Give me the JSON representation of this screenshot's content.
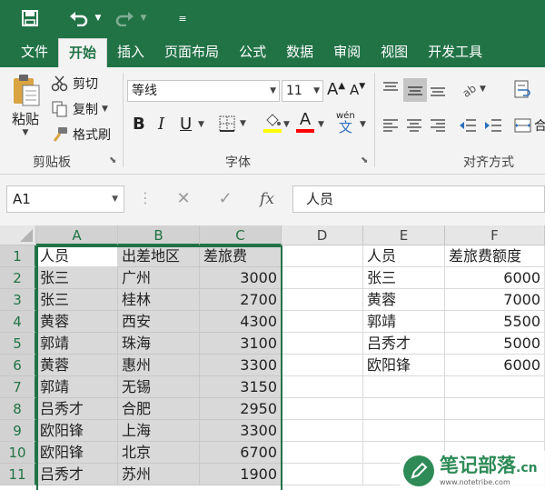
{
  "quick_access": {
    "save_icon": "save-icon",
    "undo_icon": "undo-icon",
    "redo_icon": "redo-icon",
    "customize_icon": "customize-icon"
  },
  "tabs": [
    {
      "label": "文件"
    },
    {
      "label": "开始",
      "active": true
    },
    {
      "label": "插入"
    },
    {
      "label": "页面布局"
    },
    {
      "label": "公式"
    },
    {
      "label": "数据"
    },
    {
      "label": "审阅"
    },
    {
      "label": "视图"
    },
    {
      "label": "开发工具"
    }
  ],
  "ribbon": {
    "clipboard": {
      "paste": "粘贴",
      "cut": "剪切",
      "copy": "复制",
      "format_painter": "格式刷",
      "label": "剪贴板"
    },
    "font": {
      "name": "等线",
      "size": "11",
      "label": "字体",
      "bold": "B",
      "italic": "I",
      "underline": "U",
      "grow": "A",
      "shrink": "A",
      "font_color": "A",
      "phonetic_top": "wén",
      "phonetic_bottom": "文",
      "fill_color": "#ffff00",
      "text_color": "#ff0000"
    },
    "alignment": {
      "label": "对齐方式",
      "merge_partial": "合"
    }
  },
  "formula_bar": {
    "name_box": "A1",
    "cancel": "✕",
    "enter": "✓",
    "fx": "fx",
    "content": "人员"
  },
  "grid": {
    "columns": [
      "A",
      "B",
      "C",
      "D",
      "E",
      "F"
    ],
    "rows": [
      "1",
      "2",
      "3",
      "4",
      "5",
      "6",
      "7",
      "8",
      "9",
      "10",
      "11"
    ],
    "cells": [
      [
        "人员",
        "出差地区",
        "差旅费",
        "",
        "人员",
        "差旅费额度"
      ],
      [
        "张三",
        "广州",
        "3000",
        "",
        "张三",
        "6000"
      ],
      [
        "张三",
        "桂林",
        "2700",
        "",
        "黄蓉",
        "7000"
      ],
      [
        "黄蓉",
        "西安",
        "4300",
        "",
        "郭靖",
        "5500"
      ],
      [
        "郭靖",
        "珠海",
        "3100",
        "",
        "吕秀才",
        "5000"
      ],
      [
        "黄蓉",
        "惠州",
        "3300",
        "",
        "欧阳锋",
        "6000"
      ],
      [
        "郭靖",
        "无锡",
        "3150",
        "",
        "",
        ""
      ],
      [
        "吕秀才",
        "合肥",
        "2950",
        "",
        "",
        ""
      ],
      [
        "欧阳锋",
        "上海",
        "3300",
        "",
        "",
        ""
      ],
      [
        "欧阳锋",
        "北京",
        "6700",
        "",
        "",
        ""
      ],
      [
        "吕秀才",
        "苏州",
        "1900",
        "",
        "",
        ""
      ]
    ]
  },
  "watermark": {
    "text": "笔记部落",
    "suffix": ".cn",
    "url": "www.notetribe.com"
  },
  "colors": {
    "accent": "#217346",
    "selection": "#d9d9d9"
  }
}
